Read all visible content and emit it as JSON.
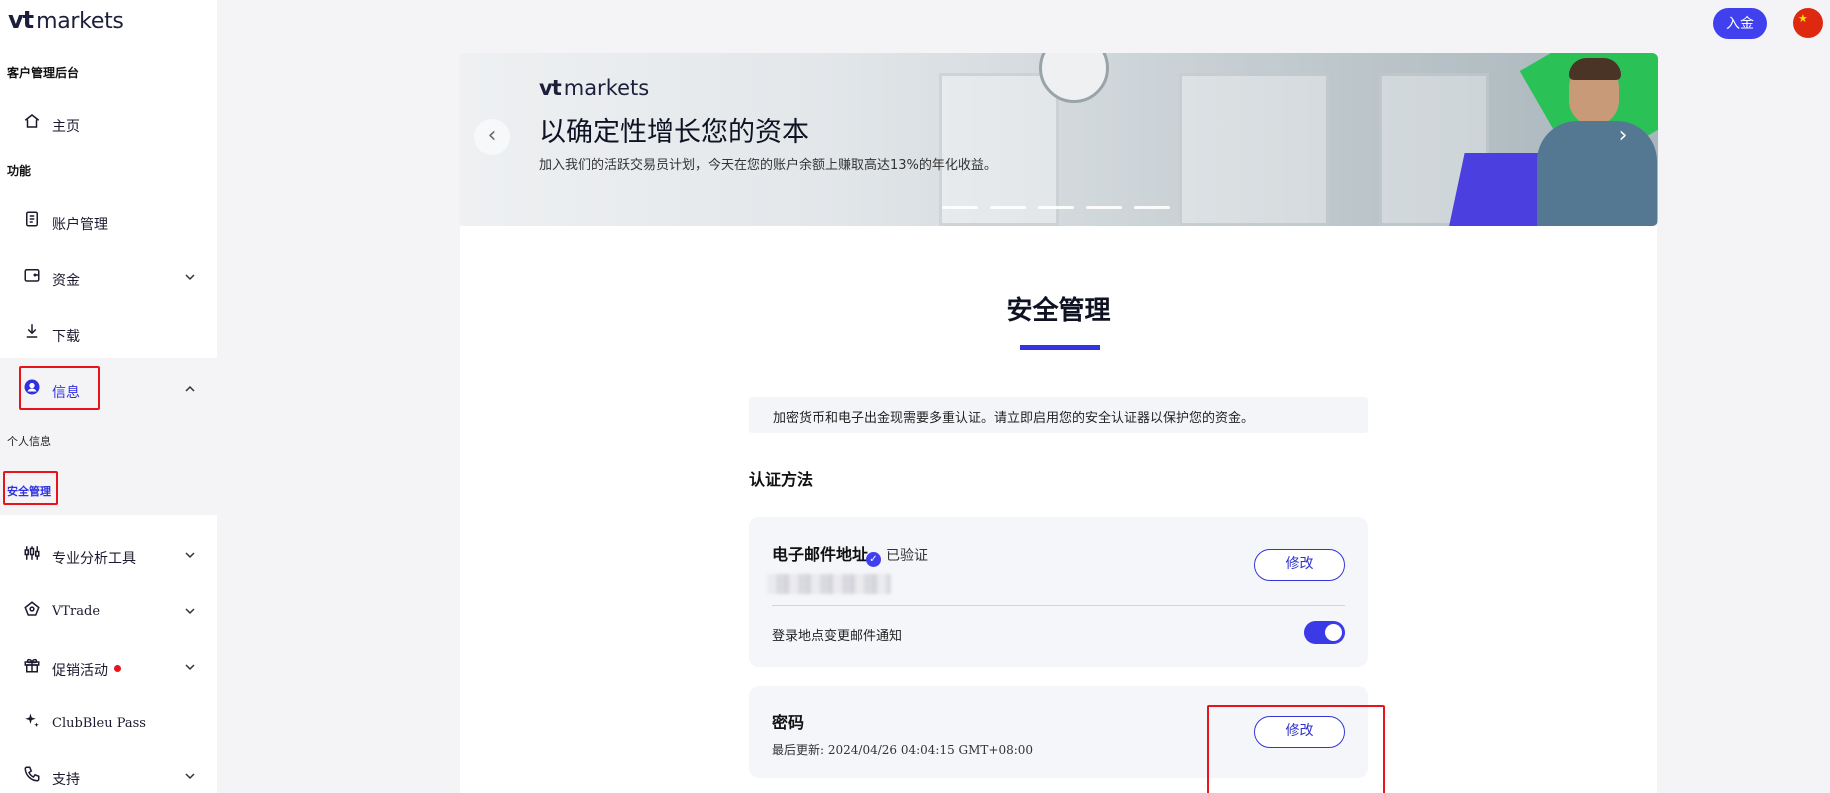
{
  "brand": {
    "logo_vt": "vt",
    "logo_word": "markets"
  },
  "sidebar": {
    "section_portal": "客户管理后台",
    "home": "主页",
    "section_features": "功能",
    "account_management": "账户管理",
    "funds": "资金",
    "download": "下载",
    "info": "信息",
    "info_sub": [
      "个人信息",
      "安全管理"
    ],
    "analysis_tools": "专业分析工具",
    "vtrade": "VTrade",
    "promotions": "促销活动",
    "clubbleu": "ClubBleu Pass",
    "support": "支持"
  },
  "header": {
    "deposit_label": "入金",
    "flag_star": "★"
  },
  "banner": {
    "logo_vt": "vt",
    "logo_word": "markets",
    "title": "以确定性增长您的资本",
    "subtitle": "加入我们的活跃交易员计划，今天在您的账户余额上赚取高达13%的年化收益。",
    "prev": "‹",
    "next": "›",
    "slide_count": 5
  },
  "main": {
    "page_title": "安全管理",
    "notice": "加密货币和电子出金现需要多重认证。请立即启用您的安全认证器以保护您的资金。",
    "auth_methods_label": "认证方法",
    "email_card": {
      "title": "电子邮件地址",
      "verified_icon": "✓",
      "verified_label": "已验证",
      "edit_label": "修改",
      "notify_label": "登录地点变更邮件通知",
      "notify_enabled": true
    },
    "password_card": {
      "title": "密码",
      "last_updated": "最后更新: 2024/04/26 04:04:15 GMT+08:00",
      "edit_label": "修改"
    }
  },
  "colors": {
    "accent": "#4040ef",
    "highlight": "#e8141a"
  }
}
